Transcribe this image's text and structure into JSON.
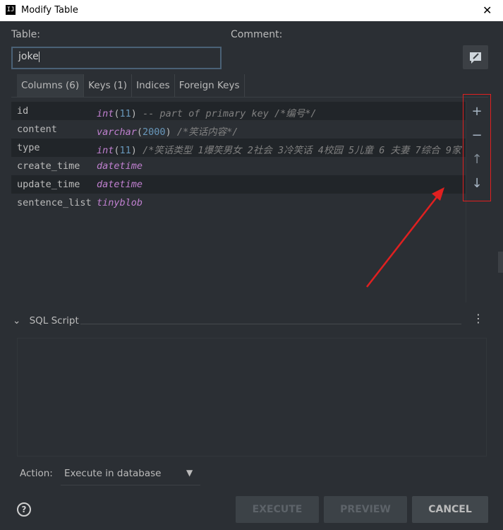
{
  "window": {
    "title": "Modify Table",
    "app_icon": "IJ"
  },
  "form": {
    "table_label": "Table:",
    "table_value": "joke",
    "comment_label": "Comment:"
  },
  "tabs": [
    {
      "label": "Columns (6)",
      "active": true
    },
    {
      "label": "Keys (1)",
      "active": false
    },
    {
      "label": "Indices",
      "active": false
    },
    {
      "label": "Foreign Keys",
      "active": false
    }
  ],
  "columns": [
    {
      "name": "id",
      "type_kw": "int",
      "type_paren_open": "(",
      "type_arg": "11",
      "type_paren_close": ")",
      "comment": " -- part of primary key /*编号*/"
    },
    {
      "name": "content",
      "type_kw": "varchar",
      "type_paren_open": "(",
      "type_arg": "2000",
      "type_paren_close": ")",
      "comment": " /*笑话内容*/"
    },
    {
      "name": "type",
      "type_kw": "int",
      "type_paren_open": "(",
      "type_arg": "11",
      "type_paren_close": ")",
      "comment": " /*笑话类型 1爆笑男女 2社会 3冷笑话 4校园 5儿童 6 夫妻 7综合 9家"
    },
    {
      "name": "create_time",
      "type_kw": "datetime",
      "type_paren_open": "",
      "type_arg": "",
      "type_paren_close": "",
      "comment": ""
    },
    {
      "name": "update_time",
      "type_kw": "datetime",
      "type_paren_open": "",
      "type_arg": "",
      "type_paren_close": "",
      "comment": ""
    },
    {
      "name": "sentence_list",
      "type_kw": "tinyblob",
      "type_paren_open": "",
      "type_arg": "",
      "type_paren_close": "",
      "comment": ""
    }
  ],
  "side_toolbar": {
    "add": "+",
    "remove": "−",
    "move_up": "↑",
    "move_down": "↓"
  },
  "sql_script": {
    "label": "SQL Script",
    "chevron": "⌄",
    "more": "⋮"
  },
  "action": {
    "label": "Action:",
    "value": "Execute in database",
    "arrow": "▼"
  },
  "buttons": {
    "help": "?",
    "execute": "EXECUTE",
    "preview": "PREVIEW",
    "cancel": "CANCEL"
  },
  "colors": {
    "annotation": "#e02020",
    "keyword": "#c080d0",
    "number": "#6897bb",
    "comment": "#808080"
  }
}
